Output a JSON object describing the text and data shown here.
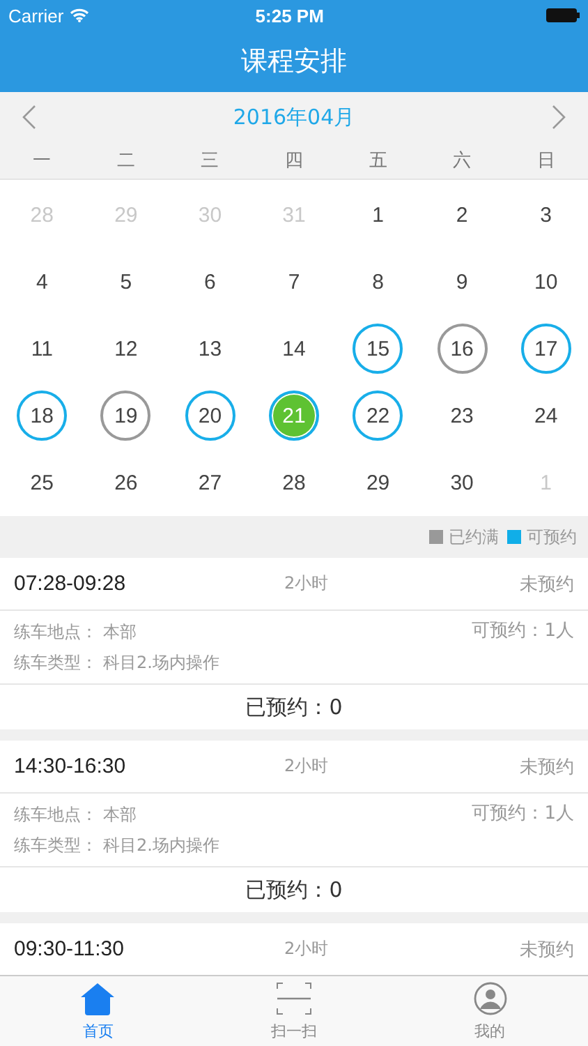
{
  "status_bar": {
    "carrier": "Carrier",
    "time": "5:25 PM"
  },
  "nav": {
    "title": "课程安排"
  },
  "calendar": {
    "month": "2016年04月",
    "weekdays": [
      "一",
      "二",
      "三",
      "四",
      "五",
      "六",
      "日"
    ],
    "days": [
      {
        "label": "28",
        "in_month": false,
        "available": false,
        "full": false,
        "selected": false
      },
      {
        "label": "29",
        "in_month": false,
        "available": false,
        "full": false,
        "selected": false
      },
      {
        "label": "30",
        "in_month": false,
        "available": false,
        "full": false,
        "selected": false
      },
      {
        "label": "31",
        "in_month": false,
        "available": false,
        "full": false,
        "selected": false
      },
      {
        "label": "1",
        "in_month": true,
        "available": false,
        "full": false,
        "selected": false
      },
      {
        "label": "2",
        "in_month": true,
        "available": false,
        "full": false,
        "selected": false
      },
      {
        "label": "3",
        "in_month": true,
        "available": false,
        "full": false,
        "selected": false
      },
      {
        "label": "4",
        "in_month": true,
        "available": false,
        "full": false,
        "selected": false
      },
      {
        "label": "5",
        "in_month": true,
        "available": false,
        "full": false,
        "selected": false
      },
      {
        "label": "6",
        "in_month": true,
        "available": false,
        "full": false,
        "selected": false
      },
      {
        "label": "7",
        "in_month": true,
        "available": false,
        "full": false,
        "selected": false
      },
      {
        "label": "8",
        "in_month": true,
        "available": false,
        "full": false,
        "selected": false
      },
      {
        "label": "9",
        "in_month": true,
        "available": false,
        "full": false,
        "selected": false
      },
      {
        "label": "10",
        "in_month": true,
        "available": false,
        "full": false,
        "selected": false
      },
      {
        "label": "11",
        "in_month": true,
        "available": false,
        "full": false,
        "selected": false
      },
      {
        "label": "12",
        "in_month": true,
        "available": false,
        "full": false,
        "selected": false
      },
      {
        "label": "13",
        "in_month": true,
        "available": false,
        "full": false,
        "selected": false
      },
      {
        "label": "14",
        "in_month": true,
        "available": false,
        "full": false,
        "selected": false
      },
      {
        "label": "15",
        "in_month": true,
        "available": true,
        "full": false,
        "selected": false
      },
      {
        "label": "16",
        "in_month": true,
        "available": false,
        "full": true,
        "selected": false
      },
      {
        "label": "17",
        "in_month": true,
        "available": true,
        "full": false,
        "selected": false
      },
      {
        "label": "18",
        "in_month": true,
        "available": true,
        "full": false,
        "selected": false
      },
      {
        "label": "19",
        "in_month": true,
        "available": false,
        "full": true,
        "selected": false
      },
      {
        "label": "20",
        "in_month": true,
        "available": true,
        "full": false,
        "selected": false
      },
      {
        "label": "21",
        "in_month": true,
        "available": true,
        "full": false,
        "selected": true
      },
      {
        "label": "22",
        "in_month": true,
        "available": true,
        "full": false,
        "selected": false
      },
      {
        "label": "23",
        "in_month": true,
        "available": false,
        "full": false,
        "selected": false
      },
      {
        "label": "24",
        "in_month": true,
        "available": false,
        "full": false,
        "selected": false
      },
      {
        "label": "25",
        "in_month": true,
        "available": false,
        "full": false,
        "selected": false
      },
      {
        "label": "26",
        "in_month": true,
        "available": false,
        "full": false,
        "selected": false
      },
      {
        "label": "27",
        "in_month": true,
        "available": false,
        "full": false,
        "selected": false
      },
      {
        "label": "28",
        "in_month": true,
        "available": false,
        "full": false,
        "selected": false
      },
      {
        "label": "29",
        "in_month": true,
        "available": false,
        "full": false,
        "selected": false
      },
      {
        "label": "30",
        "in_month": true,
        "available": false,
        "full": false,
        "selected": false
      },
      {
        "label": "1",
        "in_month": false,
        "available": false,
        "full": false,
        "selected": false
      }
    ]
  },
  "legend": [
    {
      "label": "已约满",
      "color": "#999999"
    },
    {
      "label": "可预约",
      "color": "#10aee8"
    }
  ],
  "sessions": [
    {
      "time": "07:28-09:28",
      "duration": "2小时",
      "status": "未预约",
      "place_label": "练车地点：",
      "place": "本部",
      "capacity": "可预约：1人",
      "type_label": "练车类型：",
      "type": "科目2.场内操作",
      "booked": "已预约：0"
    },
    {
      "time": "14:30-16:30",
      "duration": "2小时",
      "status": "未预约",
      "place_label": "练车地点：",
      "place": "本部",
      "capacity": "可预约：1人",
      "type_label": "练车类型：",
      "type": "科目2.场内操作",
      "booked": "已预约：0"
    },
    {
      "time": "09:30-11:30",
      "duration": "2小时",
      "status": "未预约"
    }
  ],
  "tabs": [
    {
      "label": "首页",
      "kind": "home",
      "selected": true
    },
    {
      "label": "扫一扫",
      "kind": "scan",
      "selected": false
    },
    {
      "label": "我的",
      "kind": "user",
      "selected": false
    }
  ]
}
